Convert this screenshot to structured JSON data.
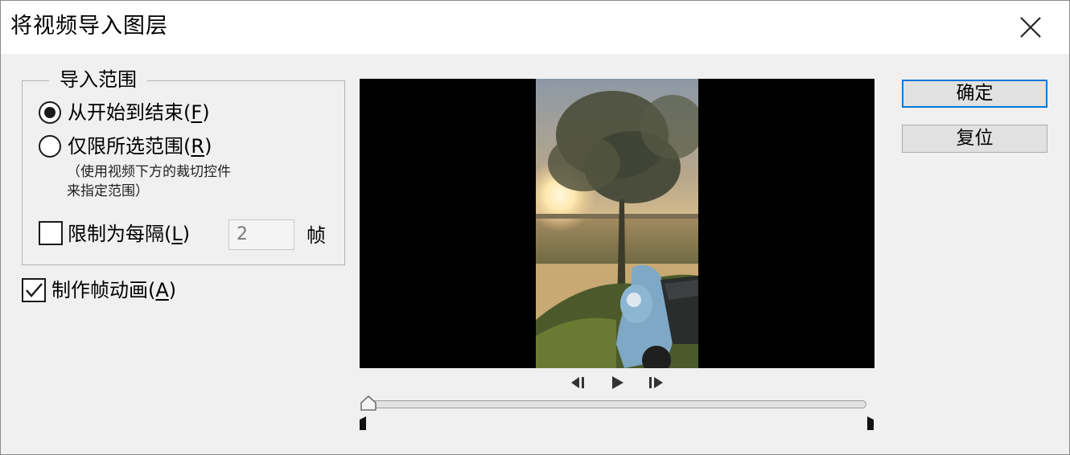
{
  "window": {
    "title": "将视频导入图层"
  },
  "import_range": {
    "legend": "导入范围",
    "options": [
      {
        "label_pre": "从开始到结束(",
        "key": "F",
        "label_post": ")",
        "selected": true
      },
      {
        "label_pre": "仅限所选范围(",
        "key": "R",
        "label_post": ")",
        "selected": false
      }
    ],
    "note_line1": "（使用视频下方的裁切控件",
    "note_line2": "来指定范围）",
    "limit": {
      "label_pre": "限制为每隔(",
      "key": "L",
      "label_post": ")",
      "checked": false,
      "value": "2",
      "unit": "帧"
    }
  },
  "frame_animation": {
    "label_pre": "制作帧动画(",
    "key": "A",
    "label_post": ")",
    "checked": true
  },
  "buttons": {
    "ok": "确定",
    "reset": "复位"
  },
  "transport": {
    "controls": [
      "previous-frame-icon",
      "play-icon",
      "next-frame-icon"
    ],
    "playhead_position": 0
  },
  "colors": {
    "accent": "#0078d7",
    "background": "#f0f0f0",
    "preview_background": "#000000"
  }
}
